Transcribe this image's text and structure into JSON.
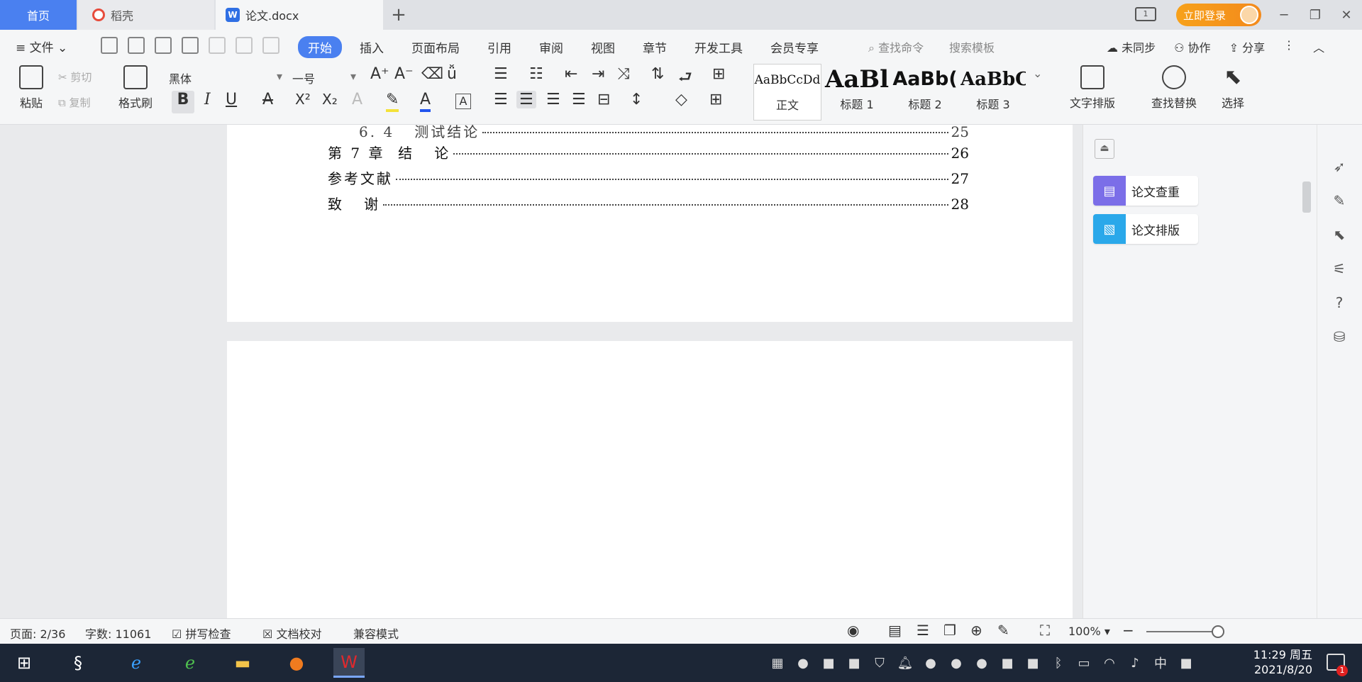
{
  "tabs": {
    "home": "首页",
    "docer": "稻壳",
    "document": "论文.docx",
    "add": "+"
  },
  "titlebar": {
    "login": "立即登录",
    "screen_label": "1",
    "minimize": "─",
    "maximize": "❐",
    "close": "✕"
  },
  "menu": {
    "file": "≡ 文件 ⌄",
    "tabs": [
      "开始",
      "插入",
      "页面布局",
      "引用",
      "审阅",
      "视图",
      "章节",
      "开发工具",
      "会员专享"
    ],
    "active_tab": "开始",
    "search_command": "查找命令",
    "search_template": "搜索模板",
    "sync": "未同步",
    "collaborate": "协作",
    "share": "分享"
  },
  "ribbon": {
    "paste": "粘贴",
    "cut": "剪切",
    "copy": "复制",
    "format_painter": "格式刷",
    "font_name": "黑体",
    "font_size": "一号",
    "bold": "B",
    "italic": "I",
    "underline": "U",
    "superscript": "X²",
    "subscript": "X₂",
    "styles": [
      {
        "preview": "AaBbCcDd",
        "label": "正文"
      },
      {
        "preview": "AaBl",
        "label": "标题 1"
      },
      {
        "preview": "AaBb(",
        "label": "标题 2"
      },
      {
        "preview": "AaBbC",
        "label": "标题 3"
      }
    ],
    "text_layout": "文字排版",
    "find_replace": "查找替换",
    "select": "选择"
  },
  "document": {
    "toc": [
      {
        "text": "6. 4   测试结论",
        "page": "25"
      },
      {
        "text": "第 7 章  结   论",
        "page": "26"
      },
      {
        "text": "参考文献",
        "page": "27"
      },
      {
        "text": "致   谢",
        "page": "28"
      }
    ]
  },
  "side_panel": {
    "paper_check": "论文查重",
    "paper_format": "论文排版"
  },
  "statusbar": {
    "page": "页面: 2/36",
    "word_count": "字数: 11061",
    "spell_check": "拼写检查",
    "doc_proof": "文档校对",
    "compat_mode": "兼容模式",
    "zoom": "100%"
  },
  "taskbar": {
    "time": "11:29 周五",
    "date": "2021/8/20",
    "ime": "中",
    "notify_count": "1"
  },
  "colors": {
    "accent": "#4a80f0",
    "login": "#f7a11a",
    "taskbar": "#1c2636"
  }
}
